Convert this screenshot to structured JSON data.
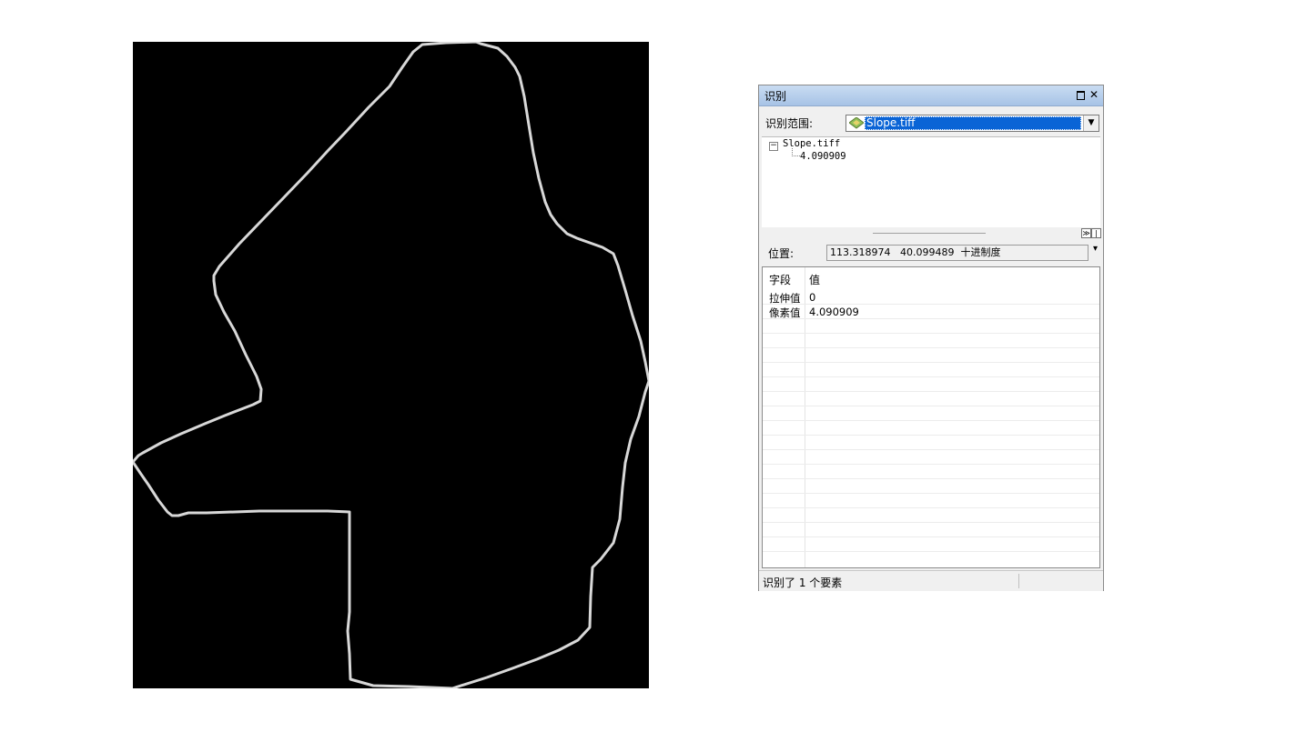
{
  "window": {
    "title": "识别",
    "maximize_label": "□",
    "close_label": "✕"
  },
  "identify_from": {
    "label": "识别范围:",
    "selected": "Slope.tiff",
    "dropdown_arrow": "▼",
    "icon": "raster-layer-icon"
  },
  "tree": {
    "expander": "−",
    "layer": "Slope.tiff",
    "value": "4.090909"
  },
  "splitter": {
    "buttons": [
      "≫",
      "|"
    ]
  },
  "location": {
    "label": "位置:",
    "value": "113.318974   40.099489  十进制度",
    "menu_label": "▾"
  },
  "attributes": {
    "columns": [
      "字段",
      "值"
    ],
    "rows": [
      {
        "field": "拉伸值",
        "value": "0"
      },
      {
        "field": "像素值",
        "value": "4.090909"
      }
    ]
  },
  "status": {
    "text": "识别了 1 个要素"
  },
  "map": {
    "background": "#000000",
    "outline_color": "#d8d8d8"
  },
  "colors": {
    "title_gradient_top": "#c9dcf2",
    "selection": "#0a64d6"
  }
}
